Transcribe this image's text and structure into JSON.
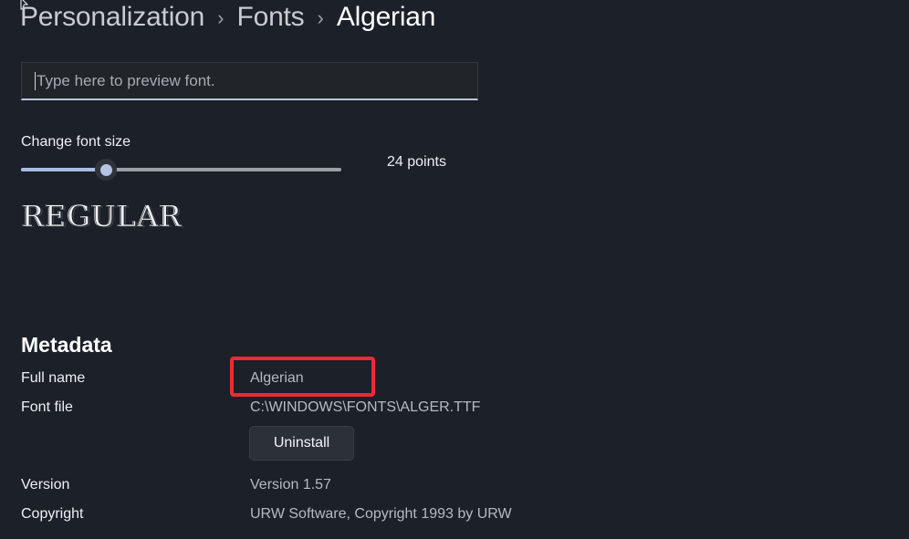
{
  "page": {
    "background_color": "#1b2029",
    "accent_color": "#a8bce4",
    "highlight_color": "#f02a32"
  },
  "breadcrumb": {
    "separator": "›",
    "items": [
      {
        "label": "Personalization",
        "current": false
      },
      {
        "label": "Fonts",
        "current": false
      },
      {
        "label": "Algerian",
        "current": true
      }
    ]
  },
  "preview": {
    "placeholder": "Type here to preview font.",
    "value": ""
  },
  "font_size": {
    "label": "Change font size",
    "value_text": "24 points",
    "points": 24,
    "min": 4,
    "max": 100,
    "fill_percent": 27
  },
  "sample": {
    "text": "REGULAR"
  },
  "metadata": {
    "title": "Metadata",
    "rows": [
      {
        "label": "Full name",
        "value": "Algerian",
        "highlighted": true
      },
      {
        "label": "Font file",
        "value": "C:\\WINDOWS\\FONTS\\ALGER.TTF",
        "highlighted": false
      },
      {
        "label": "Version",
        "value": "Version 1.57",
        "highlighted": false
      },
      {
        "label": "Copyright",
        "value": "URW Software, Copyright 1993 by URW",
        "highlighted": false
      }
    ],
    "uninstall_label": "Uninstall"
  }
}
